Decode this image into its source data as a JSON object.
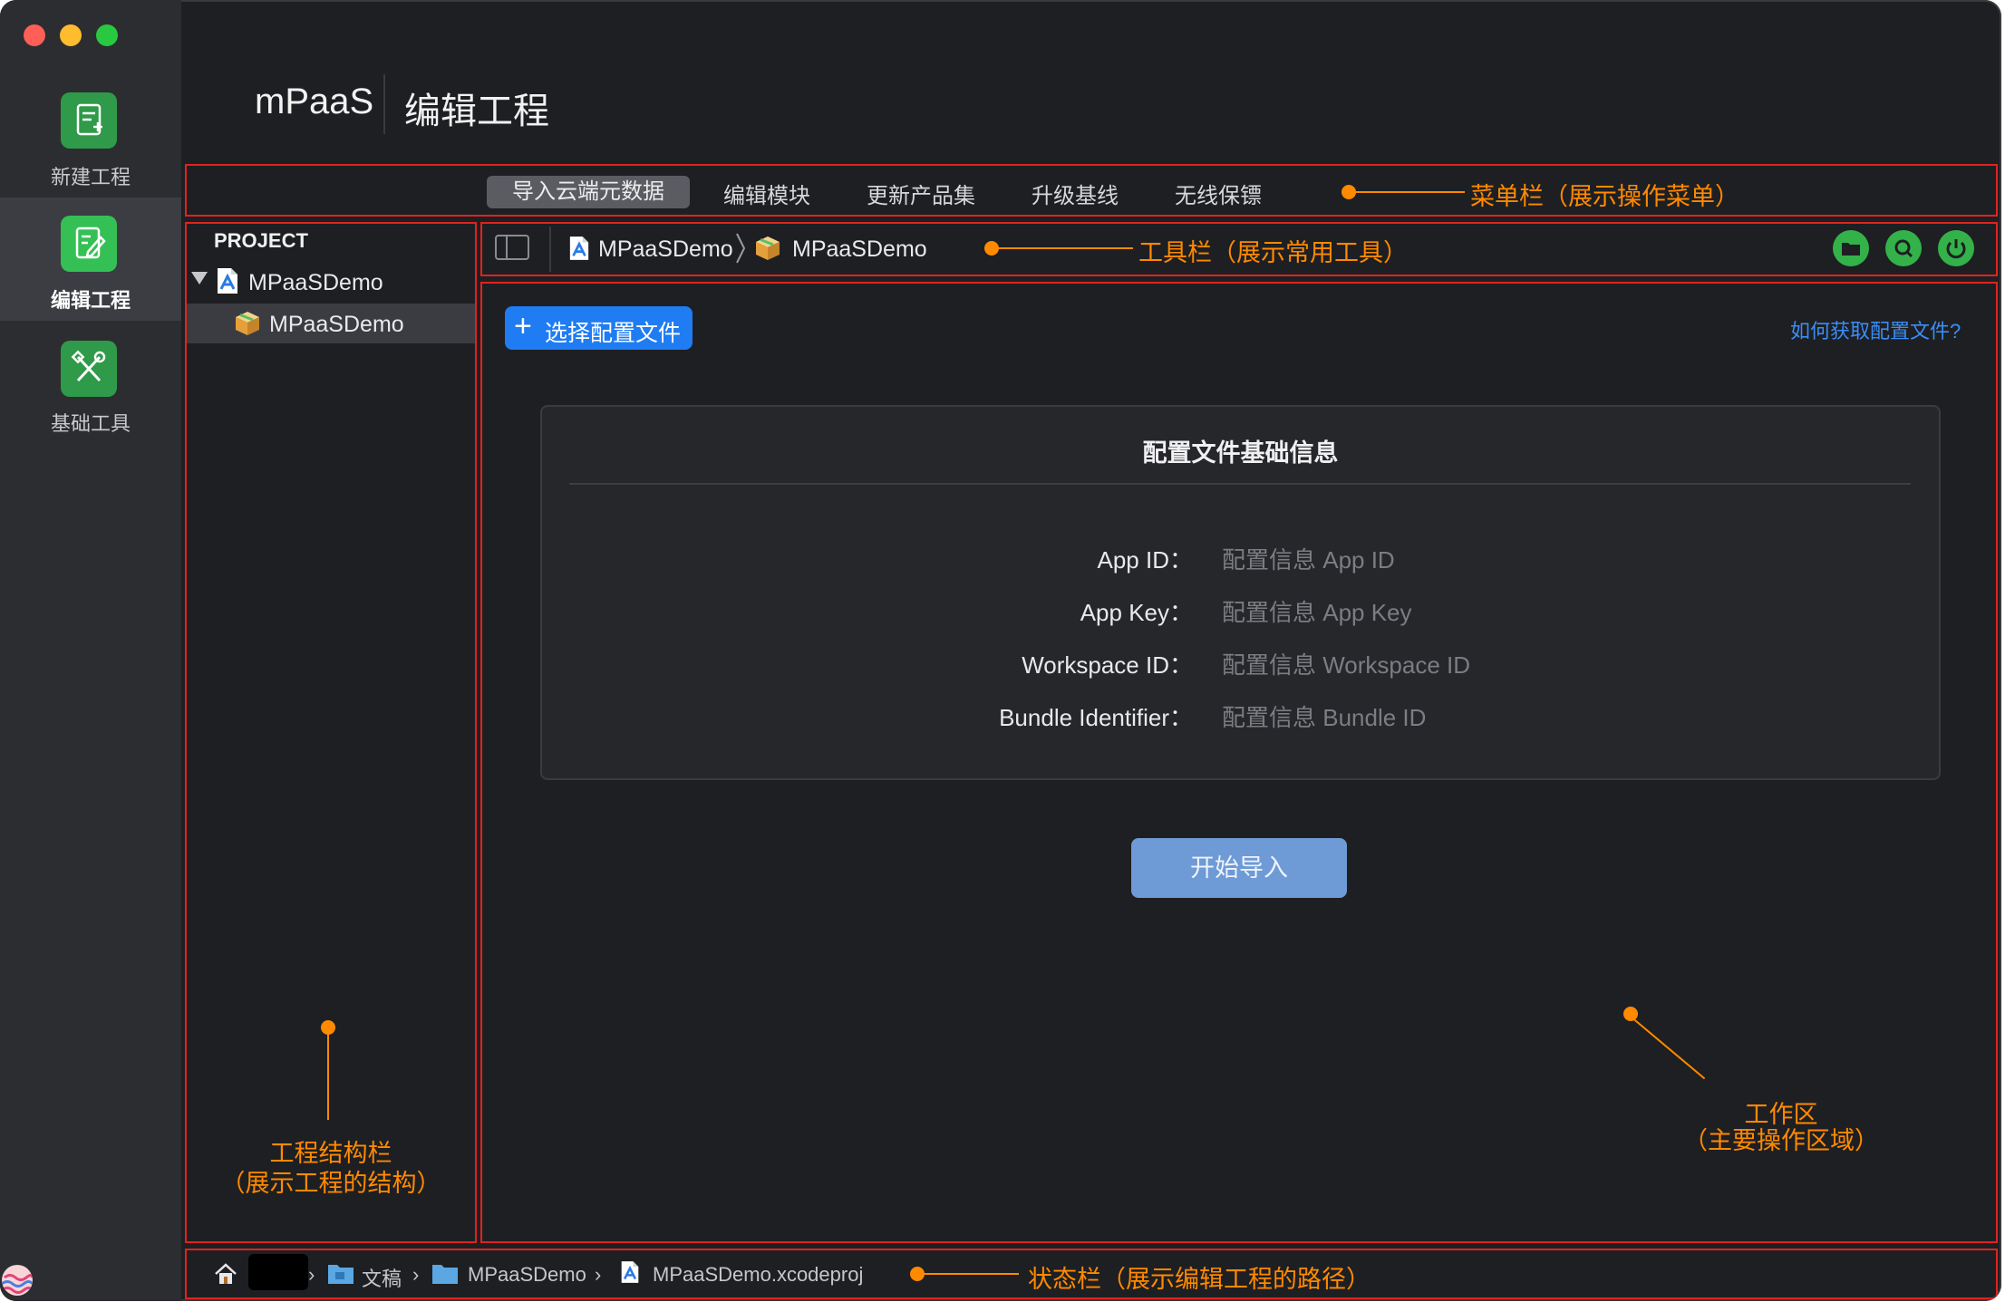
{
  "app": {
    "brand": "mPaaS",
    "page_title": "编辑工程"
  },
  "sidebar": {
    "items": [
      {
        "label": "新建工程",
        "icon": "new-project-icon",
        "active": false
      },
      {
        "label": "编辑工程",
        "icon": "edit-project-icon",
        "active": true
      },
      {
        "label": "基础工具",
        "icon": "tools-icon",
        "active": false
      }
    ]
  },
  "menu": {
    "items": [
      {
        "label": "导入云端元数据",
        "active": true
      },
      {
        "label": "编辑模块",
        "active": false
      },
      {
        "label": "更新产品集",
        "active": false
      },
      {
        "label": "升级基线",
        "active": false
      },
      {
        "label": "无线保镖",
        "active": false
      }
    ]
  },
  "project_tree": {
    "header": "PROJECT",
    "root": "MPaaSDemo",
    "child": "MPaaSDemo"
  },
  "toolbar": {
    "breadcrumb": [
      "MPaaSDemo",
      "MPaaSDemo"
    ],
    "buttons": [
      "folder-icon",
      "search-icon",
      "power-icon"
    ]
  },
  "work": {
    "choose_button": "选择配置文件",
    "help_link": "如何获取配置文件?",
    "panel_title": "配置文件基础信息",
    "fields": [
      {
        "label": "App ID：",
        "placeholder": "配置信息 App ID"
      },
      {
        "label": "App Key：",
        "placeholder": "配置信息 App Key"
      },
      {
        "label": "Workspace ID：",
        "placeholder": "配置信息 Workspace ID"
      },
      {
        "label": "Bundle Identifier：",
        "placeholder": "配置信息 Bundle ID"
      }
    ],
    "start_button": "开始导入"
  },
  "status_bar": {
    "path": [
      "文稿",
      "MPaaSDemo",
      "MPaaSDemo.xcodeproj"
    ]
  },
  "annotations": {
    "menu": "菜单栏（展示操作菜单）",
    "toolbar": "工具栏（展示常用工具）",
    "tree_line1": "工程结构栏",
    "tree_line2": "（展示工程的结构）",
    "work_line1": "工作区",
    "work_line2": "（主要操作区域）",
    "status": "状态栏（展示编辑工程的路径）"
  },
  "colors": {
    "background": "#1e1f23",
    "sidebar": "#2c2d31",
    "annotation": "#ff8a00",
    "outline": "#e0231f",
    "accent": "#1f7cf2",
    "success": "#33b24a"
  }
}
